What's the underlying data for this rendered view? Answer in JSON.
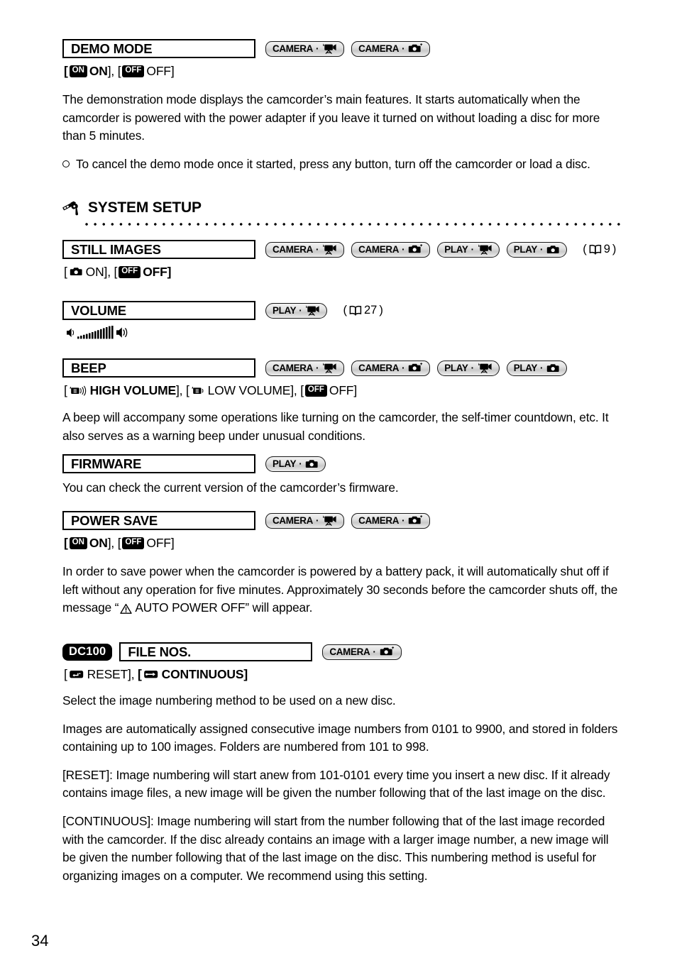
{
  "page": {
    "number": "34"
  },
  "badges": {
    "camera_video": "CAMERA",
    "camera_photo": "CAMERA",
    "play_video": "PLAY",
    "play_photo": "PLAY",
    "separator": "·",
    "dc100": "DC100"
  },
  "sections": {
    "demo_mode": {
      "title": "DEMO MODE",
      "badges": [
        "camera-video",
        "camera-photo"
      ],
      "options": {
        "on_badge": "ON",
        "on_label": "ON",
        "off_badge": "OFF",
        "off_label": "OFF",
        "prefix": "[",
        "mid": "], [",
        "suffix": "]"
      },
      "paragraph": "The demonstration mode displays the camcorder’s main features. It starts automatically when the camcorder is powered with the power adapter if you leave it turned on without loading a disc for more than 5 minutes.",
      "bullet": "To cancel the demo mode once it started, press any button, turn off the camcorder or load a disc."
    },
    "system_setup": {
      "heading": "SYSTEM SETUP",
      "icon": "wrench-screwdriver-icon"
    },
    "still_images": {
      "title": "STILL IMAGES",
      "badges": [
        "camera-video",
        "camera-photo",
        "play-video",
        "play-photo"
      ],
      "pageref": "9",
      "options": {
        "on_label": "ON",
        "off_badge": "OFF",
        "off_label": "OFF"
      }
    },
    "volume": {
      "title": "VOLUME",
      "badges": [
        "play-video"
      ],
      "pageref": "27",
      "graphic": "volume-level-bars"
    },
    "beep": {
      "title": "BEEP",
      "badges": [
        "camera-video",
        "camera-photo",
        "play-video",
        "play-photo"
      ],
      "options": {
        "high_label": "HIGH VOLUME",
        "low_label": "LOW VOLUME",
        "off_badge": "OFF",
        "off_label": "OFF"
      },
      "paragraph": "A beep will accompany some operations like turning on the camcorder, the self-timer countdown, etc. It also serves as a warning beep under unusual conditions."
    },
    "firmware": {
      "title": "FIRMWARE",
      "badges": [
        "play-photo"
      ],
      "paragraph": "You can check the current version of the camcorder’s firmware."
    },
    "power_save": {
      "title": "POWER SAVE",
      "badges": [
        "camera-video",
        "camera-photo"
      ],
      "options": {
        "on_badge": "ON",
        "on_label": "ON",
        "off_badge": "OFF",
        "off_label": "OFF"
      },
      "paragraph_part1": "In order to save power when the camcorder is powered by a battery pack, it will automatically shut off if left without any operation for five minutes. Approximately 30 seconds before the camcorder shuts off, the message “",
      "paragraph_warning_text": "AUTO POWER OFF",
      "paragraph_part2": "” will appear."
    },
    "file_nos": {
      "tag": "DC100",
      "title": "FILE NOS.",
      "badges": [
        "camera-photo"
      ],
      "options": {
        "reset_label": "RESET",
        "continuous_label": "CONTINUOUS"
      },
      "paragraph1": "Select the image numbering method to be used on a new disc.",
      "paragraph2": "Images are automatically assigned consecutive image numbers from 0101 to 9900, and stored in folders containing up to 100 images. Folders are numbered from 101 to 998.",
      "paragraph3": "[RESET]: Image numbering will start anew from 101-0101 every time you insert a new disc. If it already contains image files, a new image will be given the number following that of the last image on the disc.",
      "paragraph4": "[CONTINUOUS]: Image numbering will start from the number following that of the last image recorded with the camcorder. If the disc already contains an image with a larger image number, a new image will be given the number following that of the last image on the disc. This numbering method is useful for organizing images on a computer. We recommend using this setting."
    }
  }
}
